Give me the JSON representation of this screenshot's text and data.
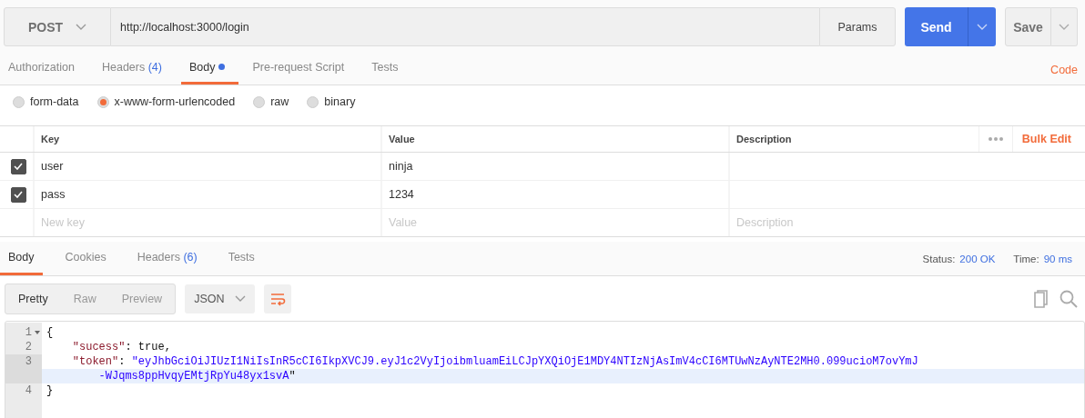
{
  "request": {
    "method": "POST",
    "url": "http://localhost:3000/login",
    "params_button": "Params",
    "send_button": "Send",
    "save_button": "Save"
  },
  "request_tabs": [
    {
      "label": "Authorization",
      "selected": false,
      "dot": false
    },
    {
      "label": "Headers",
      "badge": "(4)",
      "selected": false,
      "dot": false
    },
    {
      "label": "Body",
      "selected": true,
      "dot": true
    },
    {
      "label": "Pre-request Script",
      "selected": false,
      "dot": false
    },
    {
      "label": "Tests",
      "selected": false,
      "dot": false
    }
  ],
  "code_link": "Code",
  "body_types": [
    {
      "label": "form-data",
      "selected": false
    },
    {
      "label": "x-www-form-urlencoded",
      "selected": true
    },
    {
      "label": "raw",
      "selected": false
    },
    {
      "label": "binary",
      "selected": false
    }
  ],
  "params_table": {
    "columns": [
      "Key",
      "Value",
      "Description"
    ],
    "bulk_edit": "Bulk Edit",
    "rows": [
      {
        "checked": true,
        "key": "user",
        "value": "ninja"
      },
      {
        "checked": true,
        "key": "pass",
        "value": "1234"
      }
    ],
    "new_row": {
      "key_placeholder": "New key",
      "value_placeholder": "Value",
      "description_placeholder": "Description"
    }
  },
  "response_tabs": [
    {
      "label": "Body",
      "selected": true
    },
    {
      "label": "Cookies",
      "selected": false
    },
    {
      "label": "Headers",
      "badge": "(6)",
      "selected": false
    },
    {
      "label": "Tests",
      "selected": false
    }
  ],
  "status": {
    "status_label": "Status:",
    "status_value": "200 OK",
    "time_label": "Time:",
    "time_value": "90 ms"
  },
  "view_modes": [
    {
      "label": "Pretty",
      "selected": true
    },
    {
      "label": "Raw",
      "selected": false
    },
    {
      "label": "Preview",
      "selected": false
    }
  ],
  "format": "JSON",
  "editor": {
    "lines": [
      {
        "number": "1",
        "foldable": true,
        "active": false,
        "tokens": [
          {
            "kind": "punct",
            "text": "{"
          }
        ]
      },
      {
        "number": "2",
        "foldable": false,
        "active": false,
        "tokens": [
          {
            "kind": "key",
            "text": "    \"sucess\""
          },
          {
            "kind": "punct",
            "text": ": true,"
          }
        ]
      },
      {
        "number": "3",
        "foldable": false,
        "active": true,
        "tokens": [
          {
            "kind": "key",
            "text": "    \"token\""
          },
          {
            "kind": "punct",
            "text": ": "
          },
          {
            "kind": "string",
            "text": "\"eyJhbGciOiJIUzI1NiIsInR5cCI6IkpXVCJ9.eyJ1c2VyIjoibmluamEiLCJpYXQiOjE1MDY4NTIzNjAsImV4cCI6MTUwNzAyNTE2MH0.099ucioM7ovYmJ"
          }
        ],
        "continuation": [
          {
            "kind": "string",
            "text": "        -WJqms8ppHvqyEMtjRpYu48yx1svA"
          },
          {
            "kind": "punct",
            "text": "\""
          }
        ]
      },
      {
        "number": "4",
        "foldable": false,
        "active": false,
        "tokens": [
          {
            "kind": "punct",
            "text": "}"
          }
        ]
      }
    ]
  }
}
